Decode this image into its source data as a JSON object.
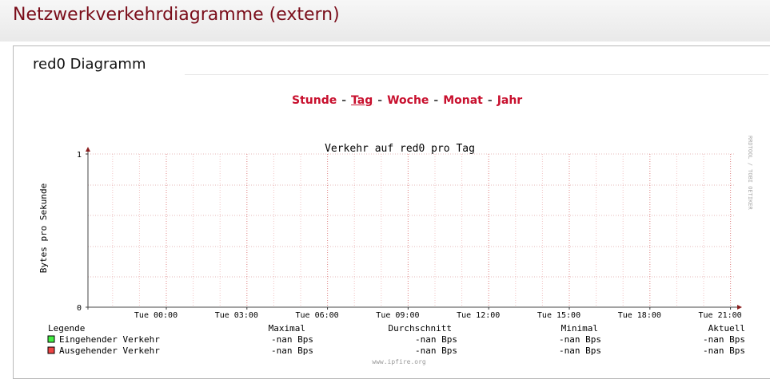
{
  "page": {
    "title": "Netzwerkverkehrdiagramme (extern)"
  },
  "panel": {
    "title": "red0 Diagramm"
  },
  "nav": {
    "items": [
      "Stunde",
      "Tag",
      "Woche",
      "Monat",
      "Jahr"
    ],
    "separator": "-",
    "active": "Tag"
  },
  "chart_data": {
    "type": "line",
    "title": "Verkehr auf red0 pro Tag",
    "ylabel": "Bytes pro Sekunde",
    "xlabel": "",
    "ylim": [
      0,
      1
    ],
    "yticks": [
      "0",
      "1"
    ],
    "xticks": [
      "Tue 00:00",
      "Tue 03:00",
      "Tue 06:00",
      "Tue 09:00",
      "Tue 12:00",
      "Tue 15:00",
      "Tue 18:00",
      "Tue 21:00"
    ],
    "grid": true,
    "watermark": "RRDTOOL / TOBI OETIKER",
    "footer": "www.ipfire.org",
    "legend": {
      "header": [
        "Legende",
        "Maximal",
        "Durchschnitt",
        "Minimal",
        "Aktuell"
      ],
      "series": [
        {
          "name": "Eingehender Verkehr",
          "color": "#44ee44",
          "maximal": "-nan  Bps",
          "durchschnitt": "-nan  Bps",
          "minimal": "-nan  Bps",
          "aktuell": "-nan  Bps"
        },
        {
          "name": "Ausgehender Verkehr",
          "color": "#ee4444",
          "maximal": "-nan  Bps",
          "durchschnitt": "-nan  Bps",
          "minimal": "-nan  Bps",
          "aktuell": "-nan  Bps"
        }
      ]
    },
    "series": [
      {
        "name": "Eingehender Verkehr",
        "values": []
      },
      {
        "name": "Ausgehender Verkehr",
        "values": []
      }
    ]
  }
}
